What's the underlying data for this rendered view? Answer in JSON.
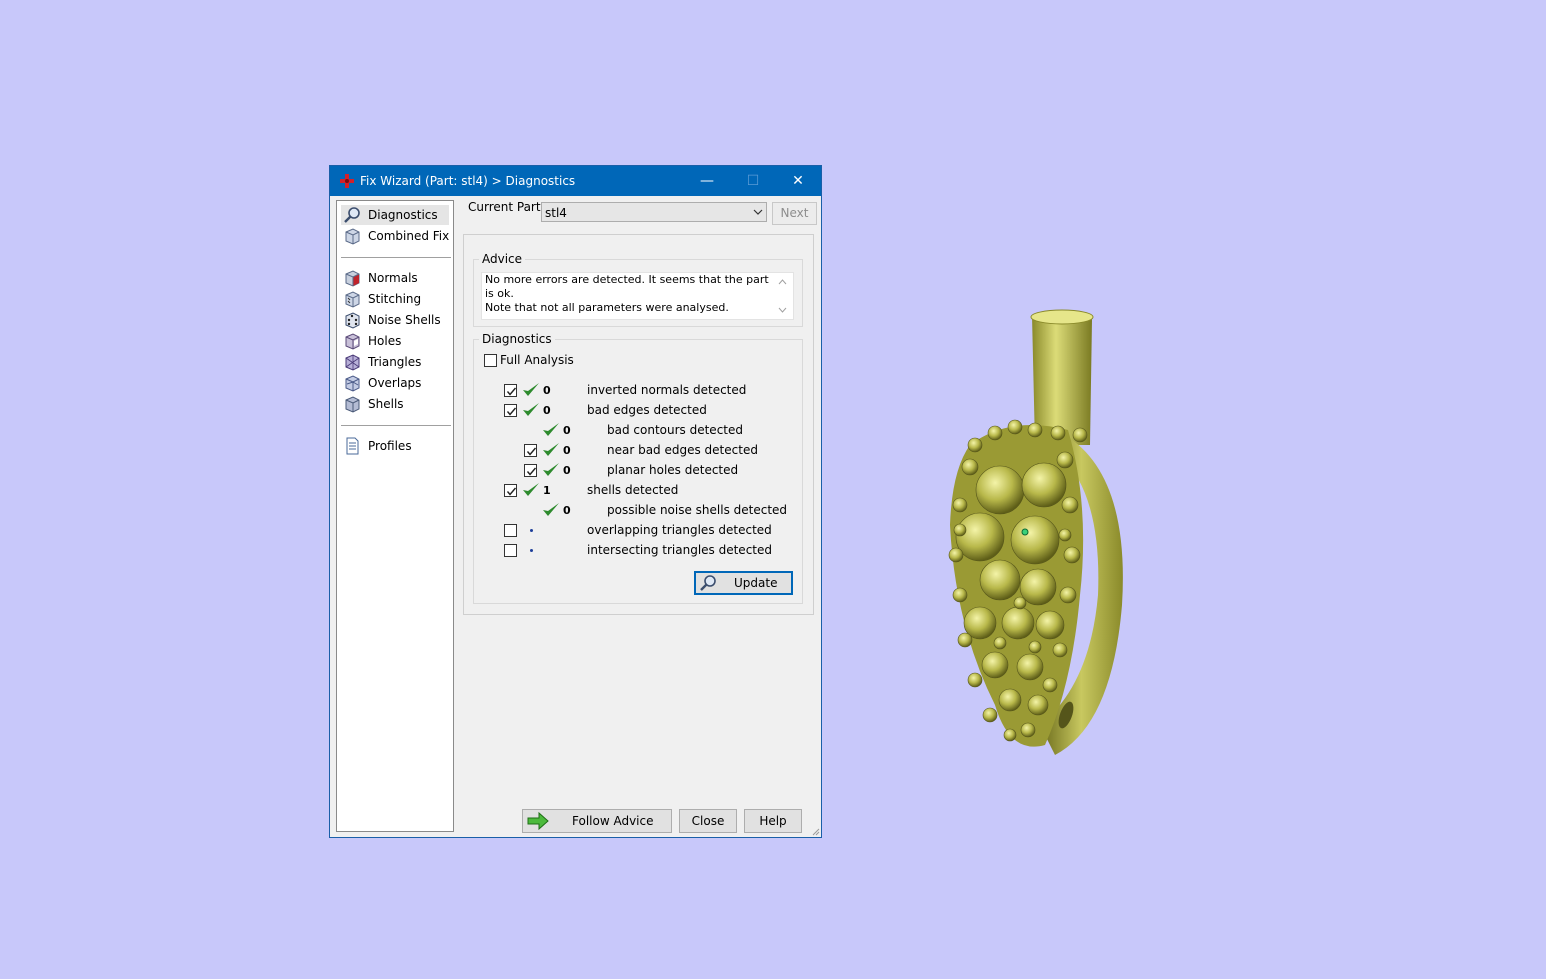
{
  "window": {
    "title": "Fix Wizard (Part: stl4) > Diagnostics",
    "minimize_glyph": "—",
    "maximize_glyph": "☐",
    "close_glyph": "✕"
  },
  "sidebar": {
    "items": [
      {
        "label": "Diagnostics",
        "icon": "magnifier-icon",
        "selected": true
      },
      {
        "label": "Combined Fix",
        "icon": "cube-icon"
      },
      {
        "label": "Normals",
        "icon": "cube-red-face-icon"
      },
      {
        "label": "Stitching",
        "icon": "cube-stitch-icon"
      },
      {
        "label": "Noise Shells",
        "icon": "dice-icon"
      },
      {
        "label": "Holes",
        "icon": "cube-hole-icon"
      },
      {
        "label": "Triangles",
        "icon": "triangles-icon"
      },
      {
        "label": "Overlaps",
        "icon": "overlap-icon"
      },
      {
        "label": "Shells",
        "icon": "shells-icon"
      },
      {
        "label": "Profiles",
        "icon": "document-icon"
      }
    ]
  },
  "current_part": {
    "label": "Current Part:",
    "value": "stl4",
    "next_label": "Next"
  },
  "advice": {
    "title": "Advice",
    "text_line1": "No more errors are detected. It seems that the part is ok.",
    "text_line2": "Note that not all parameters were analysed."
  },
  "diagnostics": {
    "title": "Diagnostics",
    "full_analysis_label": "Full Analysis",
    "full_analysis_checked": false,
    "rows": [
      {
        "checkbox": true,
        "checked": true,
        "status": "ok",
        "count": "0",
        "label": "inverted normals detected",
        "indent": 0
      },
      {
        "checkbox": true,
        "checked": true,
        "status": "ok",
        "count": "0",
        "label": "bad edges detected",
        "indent": 0
      },
      {
        "checkbox": false,
        "checked": false,
        "status": "ok",
        "count": "0",
        "label": "bad contours detected",
        "indent": 1
      },
      {
        "checkbox": true,
        "checked": true,
        "status": "ok",
        "count": "0",
        "label": "near bad edges detected",
        "indent": 1
      },
      {
        "checkbox": true,
        "checked": true,
        "status": "ok",
        "count": "0",
        "label": "planar holes detected",
        "indent": 1
      },
      {
        "checkbox": true,
        "checked": true,
        "status": "ok",
        "count": "1",
        "label": "shells detected",
        "indent": 0
      },
      {
        "checkbox": false,
        "checked": false,
        "status": "ok",
        "count": "0",
        "label": "possible noise shells detected",
        "indent": 1
      },
      {
        "checkbox": true,
        "checked": false,
        "status": "pending",
        "count": "",
        "label": "overlapping triangles detected",
        "indent": 0
      },
      {
        "checkbox": true,
        "checked": false,
        "status": "pending",
        "count": "",
        "label": "intersecting triangles detected",
        "indent": 0
      }
    ],
    "update_label": "Update"
  },
  "footer": {
    "follow_advice_label": "Follow Advice",
    "close_label": "Close",
    "help_label": "Help"
  },
  "colors": {
    "background": "#c8c8fa",
    "titlebar": "#0067b8",
    "check_green": "#2e8b2e",
    "model_yellow": "#b8b84a"
  }
}
